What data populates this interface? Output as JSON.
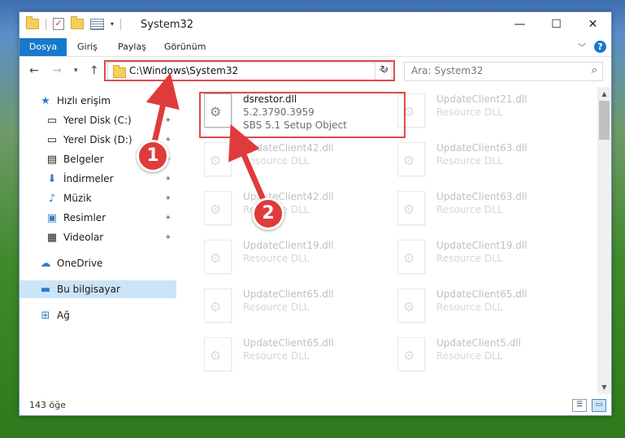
{
  "window": {
    "title": "System32",
    "controls": {
      "minimize": "—",
      "maximize": "☐",
      "close": "✕"
    }
  },
  "ribbon": {
    "tabs": [
      "Dosya",
      "Giriş",
      "Paylaş",
      "Görünüm"
    ],
    "help": "?"
  },
  "address": {
    "path": "C:\\Windows\\System32",
    "search_placeholder": "Ara: System32"
  },
  "sidebar": {
    "items": [
      {
        "label": "Hızlı erişim",
        "icon": "star-icon"
      },
      {
        "label": "Yerel Disk (C:)",
        "icon": "drive-icon",
        "pinned": true
      },
      {
        "label": "Yerel Disk (D:)",
        "icon": "drive-icon",
        "pinned": true
      },
      {
        "label": "Belgeler",
        "icon": "documents-icon",
        "pinned": true
      },
      {
        "label": "İndirmeler",
        "icon": "download-icon",
        "pinned": true
      },
      {
        "label": "Müzik",
        "icon": "music-icon",
        "pinned": true
      },
      {
        "label": "Resimler",
        "icon": "pictures-icon",
        "pinned": true
      },
      {
        "label": "Videolar",
        "icon": "videos-icon",
        "pinned": true
      },
      {
        "label": "OneDrive",
        "icon": "cloud-icon"
      },
      {
        "label": "Bu bilgisayar",
        "icon": "computer-icon",
        "selected": true
      },
      {
        "label": "Ağ",
        "icon": "network-icon"
      }
    ]
  },
  "files": [
    {
      "name": "dsrestor.dll",
      "version": "5.2.3790.3959",
      "description": "SBS 5.1 Setup Object"
    },
    {
      "name": "UpdateClient21.dll",
      "description": "Resource DLL"
    },
    {
      "name": "UpdateClient42.dll",
      "description": "Resource DLL"
    },
    {
      "name": "UpdateClient63.dll",
      "description": "Resource DLL"
    },
    {
      "name": "UpdateClient42.dll",
      "description": "Resource DLL"
    },
    {
      "name": "UpdateClient63.dll",
      "description": "Resource DLL"
    },
    {
      "name": "UpdateClient19.dll",
      "description": "Resource DLL"
    },
    {
      "name": "UpdateClient19.dll",
      "description": "Resource DLL"
    },
    {
      "name": "UpdateClient65.dll",
      "description": "Resource DLL"
    },
    {
      "name": "UpdateClient65.dll",
      "description": "Resource DLL"
    },
    {
      "name": "UpdateClient65.dll",
      "description": "Resource DLL"
    },
    {
      "name": "UpdateClient5.dll",
      "description": "Resource DLL"
    }
  ],
  "status": {
    "item_count": "143 öğe"
  },
  "annotations": {
    "step1": "1",
    "step2": "2",
    "color": "#e03b3b"
  }
}
